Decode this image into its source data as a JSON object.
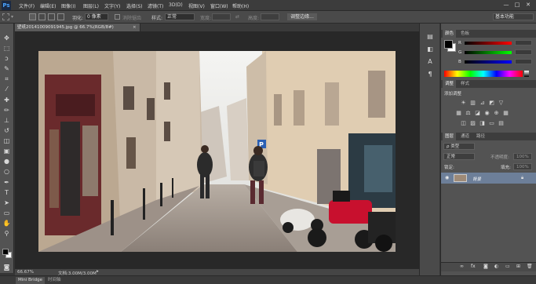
{
  "app": {
    "logo": "Ps"
  },
  "menu": [
    "文件(F)",
    "编辑(E)",
    "图像(I)",
    "图层(L)",
    "文字(Y)",
    "选择(S)",
    "滤镜(T)",
    "3D(D)",
    "视图(V)",
    "窗口(W)",
    "帮助(H)"
  ],
  "window_controls": {
    "minimize": "—",
    "maximize": "□",
    "close": "✕"
  },
  "options": {
    "feather_label": "羽化:",
    "feather_value": "0 像素",
    "antialias_label": "消除锯齿",
    "style_label": "样式:",
    "style_value": "正常",
    "width_label": "宽度:",
    "height_label": "高度:",
    "refine_button": "调整边缘...",
    "workspace": "基本功能"
  },
  "document": {
    "tab_title": "壁纸20141009091945.jpg @ 66.7%(RGB/8#)",
    "close": "×"
  },
  "status": {
    "zoom": "66.67%",
    "doc_info": "文档:3.00M/3.00M"
  },
  "bottom_tabs": [
    "Mini Bridge",
    "时间轴"
  ],
  "color_panel": {
    "tabs": [
      "颜色",
      "色板"
    ],
    "r_label": "R",
    "g_label": "G",
    "b_label": "B"
  },
  "adjustments_panel": {
    "tabs": [
      "调整",
      "样式"
    ],
    "title": "添加调整"
  },
  "layers_panel": {
    "tabs": [
      "图层",
      "通道",
      "路径"
    ],
    "kind_label": "ρ 类型",
    "blend_mode": "正常",
    "opacity_label": "不透明度:",
    "opacity_value": "100%",
    "lock_label": "锁定:",
    "fill_label": "填充:",
    "fill_value": "100%",
    "layer_name": "背景"
  },
  "colors": {
    "foreground": "#000000",
    "background": "#ffffff",
    "accent_ps": "#4aa3ff"
  }
}
